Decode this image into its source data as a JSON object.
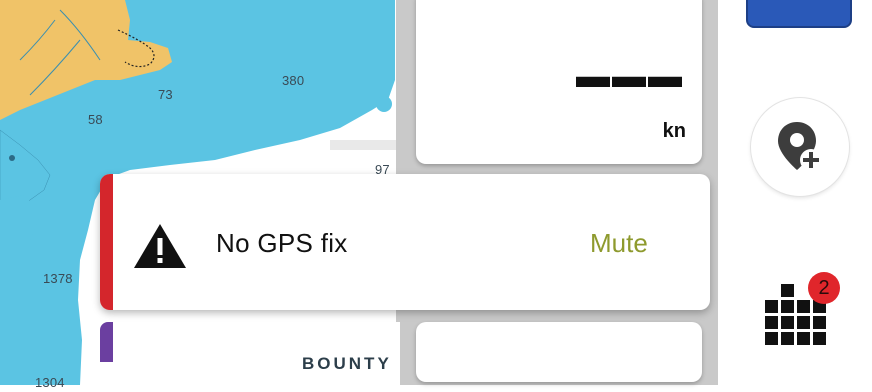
{
  "map": {
    "depths": [
      "380",
      "73",
      "58",
      "97",
      "1378",
      "1304"
    ],
    "place_label": "BOUNTY",
    "colors": {
      "water": "#5bc4e3",
      "land": "#f0c368",
      "background": "#ffffff"
    }
  },
  "speed_panel": {
    "value": "▬▬▬",
    "unit": "kn"
  },
  "alert": {
    "message": "No GPS fix",
    "action_label": "Mute",
    "severity_color": "#d4262c",
    "icon": "warning-triangle-icon"
  },
  "sidebar": {
    "waypoint_button_icon": "add-waypoint-icon",
    "apps_button_icon": "apps-grid-icon",
    "notification_count": "2"
  }
}
